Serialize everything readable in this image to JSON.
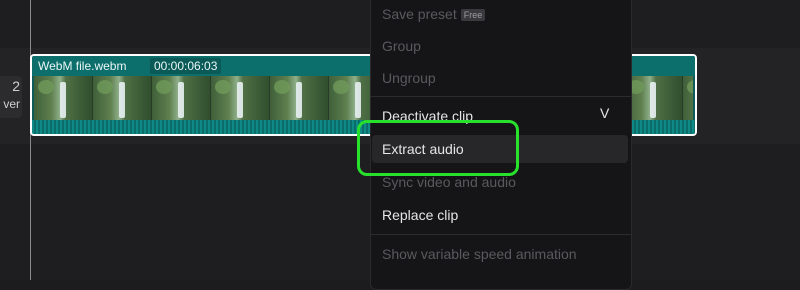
{
  "track": {
    "side_number": "2",
    "side_text": "ver"
  },
  "clip": {
    "name": "WebM file.webm",
    "timecode": "00:00:06:03"
  },
  "menu": {
    "items": [
      {
        "label": "Save preset",
        "badge": "Free",
        "disabled": true
      },
      {
        "label": "Group",
        "disabled": true
      },
      {
        "label": "Ungroup",
        "disabled": true
      },
      {
        "label": "Deactivate clip",
        "shortcut": "V",
        "disabled": false
      },
      {
        "label": "Extract audio",
        "disabled": false,
        "highlighted": true
      },
      {
        "label": "Sync video and audio",
        "disabled": true
      },
      {
        "label": "Replace clip",
        "disabled": false
      },
      {
        "label": "Show variable speed animation",
        "disabled": true
      }
    ]
  },
  "colors": {
    "focus_ring": "#28e12c",
    "clip_fill": "#0c6f6c",
    "menu_bg": "#151517"
  }
}
